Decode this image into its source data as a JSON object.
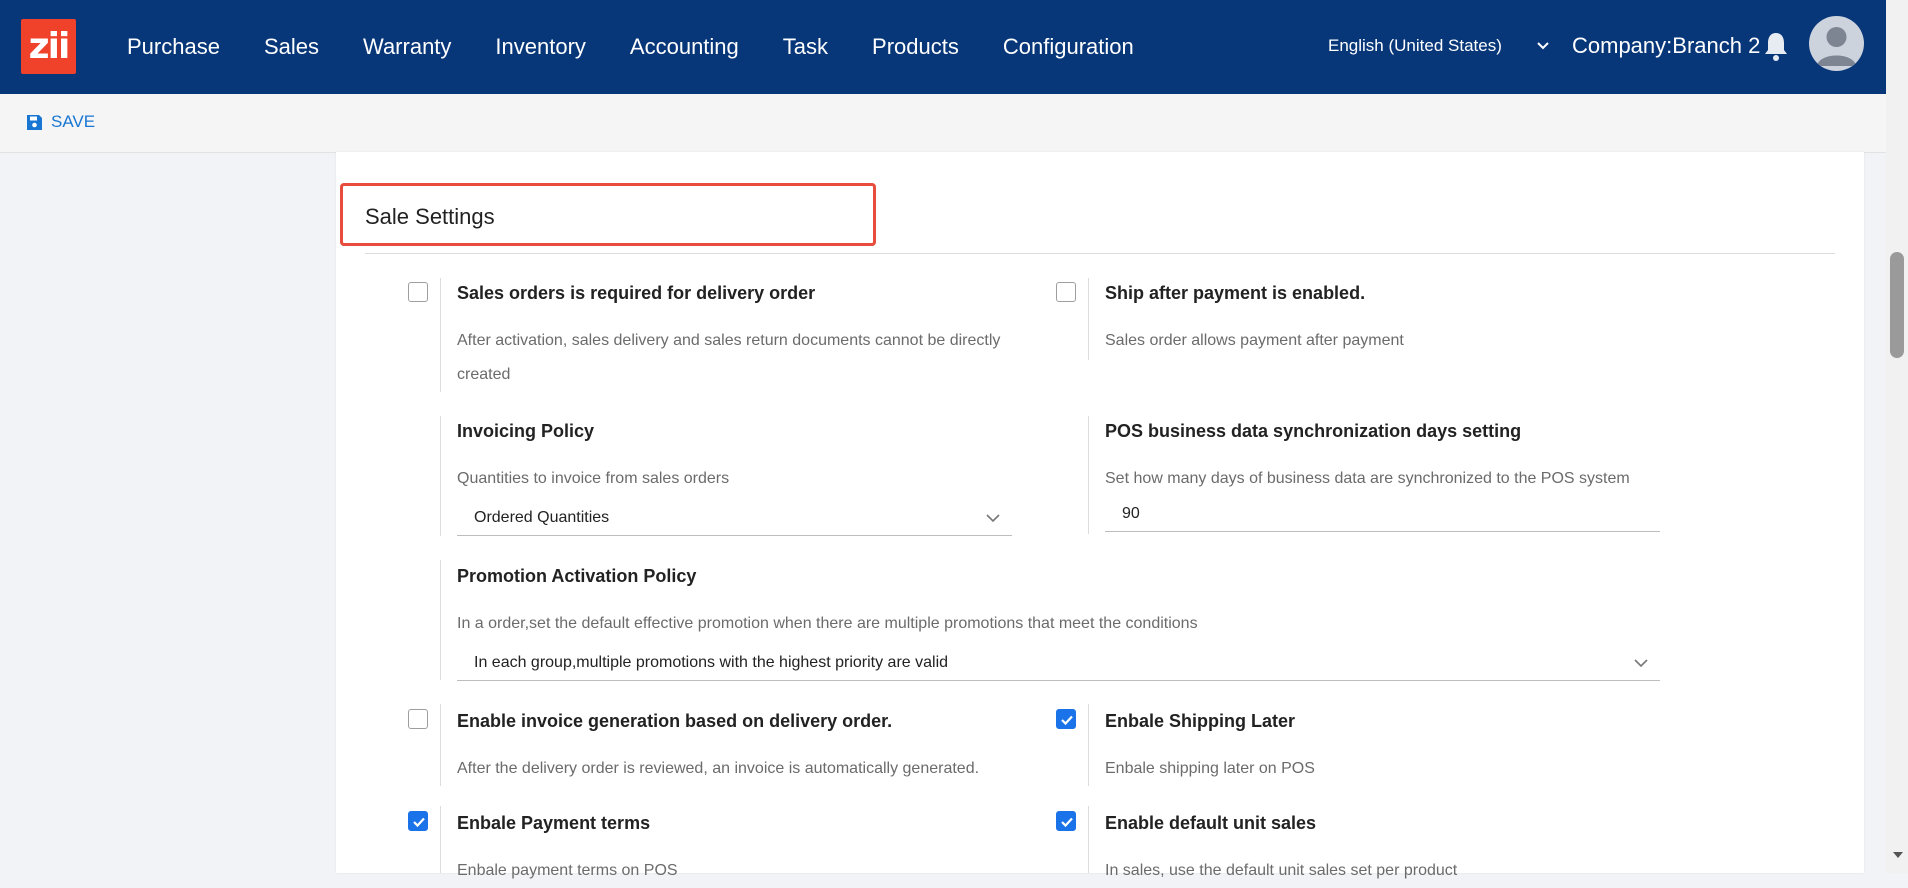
{
  "app": {
    "logo_text": "zii",
    "nav": [
      "Purchase",
      "Sales",
      "Warranty",
      "Inventory",
      "Accounting",
      "Task",
      "Products",
      "Configuration"
    ],
    "language": "English (United States)",
    "company": "Company:Branch 2"
  },
  "toolbar": {
    "save_label": "SAVE"
  },
  "section": {
    "title": "Sale Settings"
  },
  "settings": {
    "sales_order_required": {
      "label": "Sales orders is required for delivery order",
      "desc_line1": "After activation, sales delivery and sales return documents cannot be directly",
      "desc_line2": "created",
      "checked": false
    },
    "ship_after_payment": {
      "label": "Ship after payment is enabled.",
      "desc": "Sales order allows payment after payment",
      "checked": false
    },
    "invoicing_policy": {
      "label": "Invoicing Policy",
      "desc": "Quantities to invoice from sales orders",
      "value": "Ordered Quantities"
    },
    "pos_sync_days": {
      "label": "POS business data synchronization days setting",
      "desc": "Set how many days of business data are synchronized to the POS system",
      "value": "90"
    },
    "promotion_policy": {
      "label": "Promotion Activation Policy",
      "desc": "In a order,set the default effective promotion when there are multiple promotions that meet the conditions",
      "value": "In each group,multiple promotions with the highest priority are valid"
    },
    "invoice_from_delivery": {
      "label": "Enable invoice generation based on delivery order.",
      "desc": "After the delivery order is reviewed, an invoice is automatically generated.",
      "checked": false
    },
    "shipping_later": {
      "label": "Enbale Shipping Later",
      "desc": "Enbale shipping later on POS",
      "checked": true
    },
    "payment_terms": {
      "label": "Enbale Payment terms",
      "desc": "Enbale payment terms on POS",
      "checked": true
    },
    "default_unit_sales": {
      "label": "Enable default unit sales",
      "desc": "In sales, use the default unit sales set per product",
      "checked": true
    }
  },
  "colors": {
    "header_bg": "#073779",
    "accent": "#1a73e8",
    "highlight": "#e74c3c",
    "logo_bg": "#f0412a"
  }
}
